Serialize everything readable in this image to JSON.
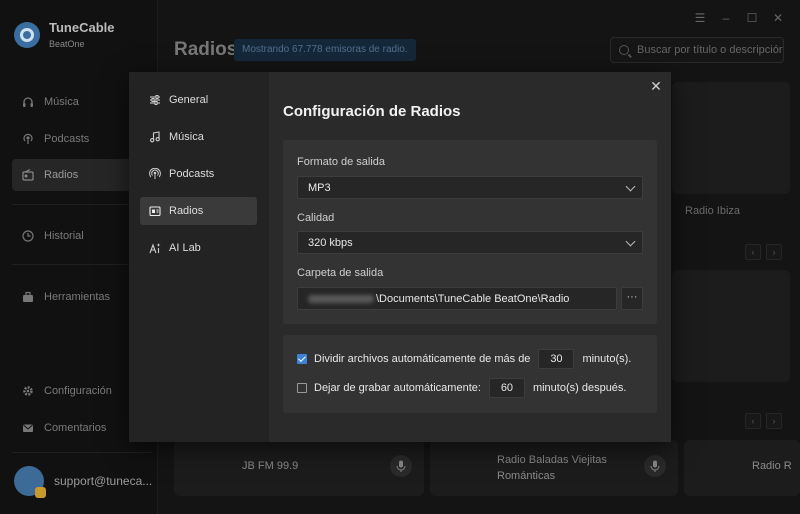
{
  "app": {
    "name": "TuneCable",
    "subtitle": "BeatOne"
  },
  "sidebar": {
    "items": [
      {
        "label": "Música",
        "icon": "headphones-icon"
      },
      {
        "label": "Podcasts",
        "icon": "podcast-icon"
      },
      {
        "label": "Radios",
        "icon": "radio-icon"
      },
      {
        "label": "Historial",
        "icon": "clock-icon"
      },
      {
        "label": "Herramientas",
        "icon": "toolbox-icon"
      },
      {
        "label": "Configuración",
        "icon": "gear-icon"
      },
      {
        "label": "Comentarios",
        "icon": "mail-icon"
      }
    ],
    "user_email": "support@tuneca..."
  },
  "header": {
    "title": "Radios",
    "count_text": "Mostrando 67.778 emisoras de radio.",
    "search_placeholder": "Buscar por título o descripción"
  },
  "background": {
    "station_label": "Radio Ibiza",
    "cards": [
      "JB FM 99.9",
      "Radio Baladas Viejitas Románticas",
      "Radio R"
    ]
  },
  "dialog": {
    "title": "Configuración de Radios",
    "nav": [
      {
        "label": "General",
        "icon": "sliders-icon"
      },
      {
        "label": "Música",
        "icon": "music-note-icon"
      },
      {
        "label": "Podcasts",
        "icon": "podcast-icon"
      },
      {
        "label": "Radios",
        "icon": "radio-icon"
      },
      {
        "label": "AI Lab",
        "icon": "ai-icon"
      }
    ],
    "active_nav": "Radios",
    "output_format_label": "Formato de salida",
    "output_format_value": "MP3",
    "quality_label": "Calidad",
    "quality_value": "320 kbps",
    "output_folder_label": "Carpeta de salida",
    "output_folder_value": "\\Documents\\TuneCable BeatOne\\Radio",
    "browse_label": "···",
    "split_enabled": true,
    "split_label": "Dividir archivos automáticamente de más de",
    "split_minutes": "30",
    "split_unit": "minuto(s).",
    "stop_enabled": false,
    "stop_label": "Dejar de grabar automáticamente:",
    "stop_minutes": "60",
    "stop_unit": "minuto(s) después."
  },
  "colors": {
    "accent": "#3d82d6",
    "dialog_bg": "#2a2a2a",
    "panel_bg": "#333333"
  }
}
